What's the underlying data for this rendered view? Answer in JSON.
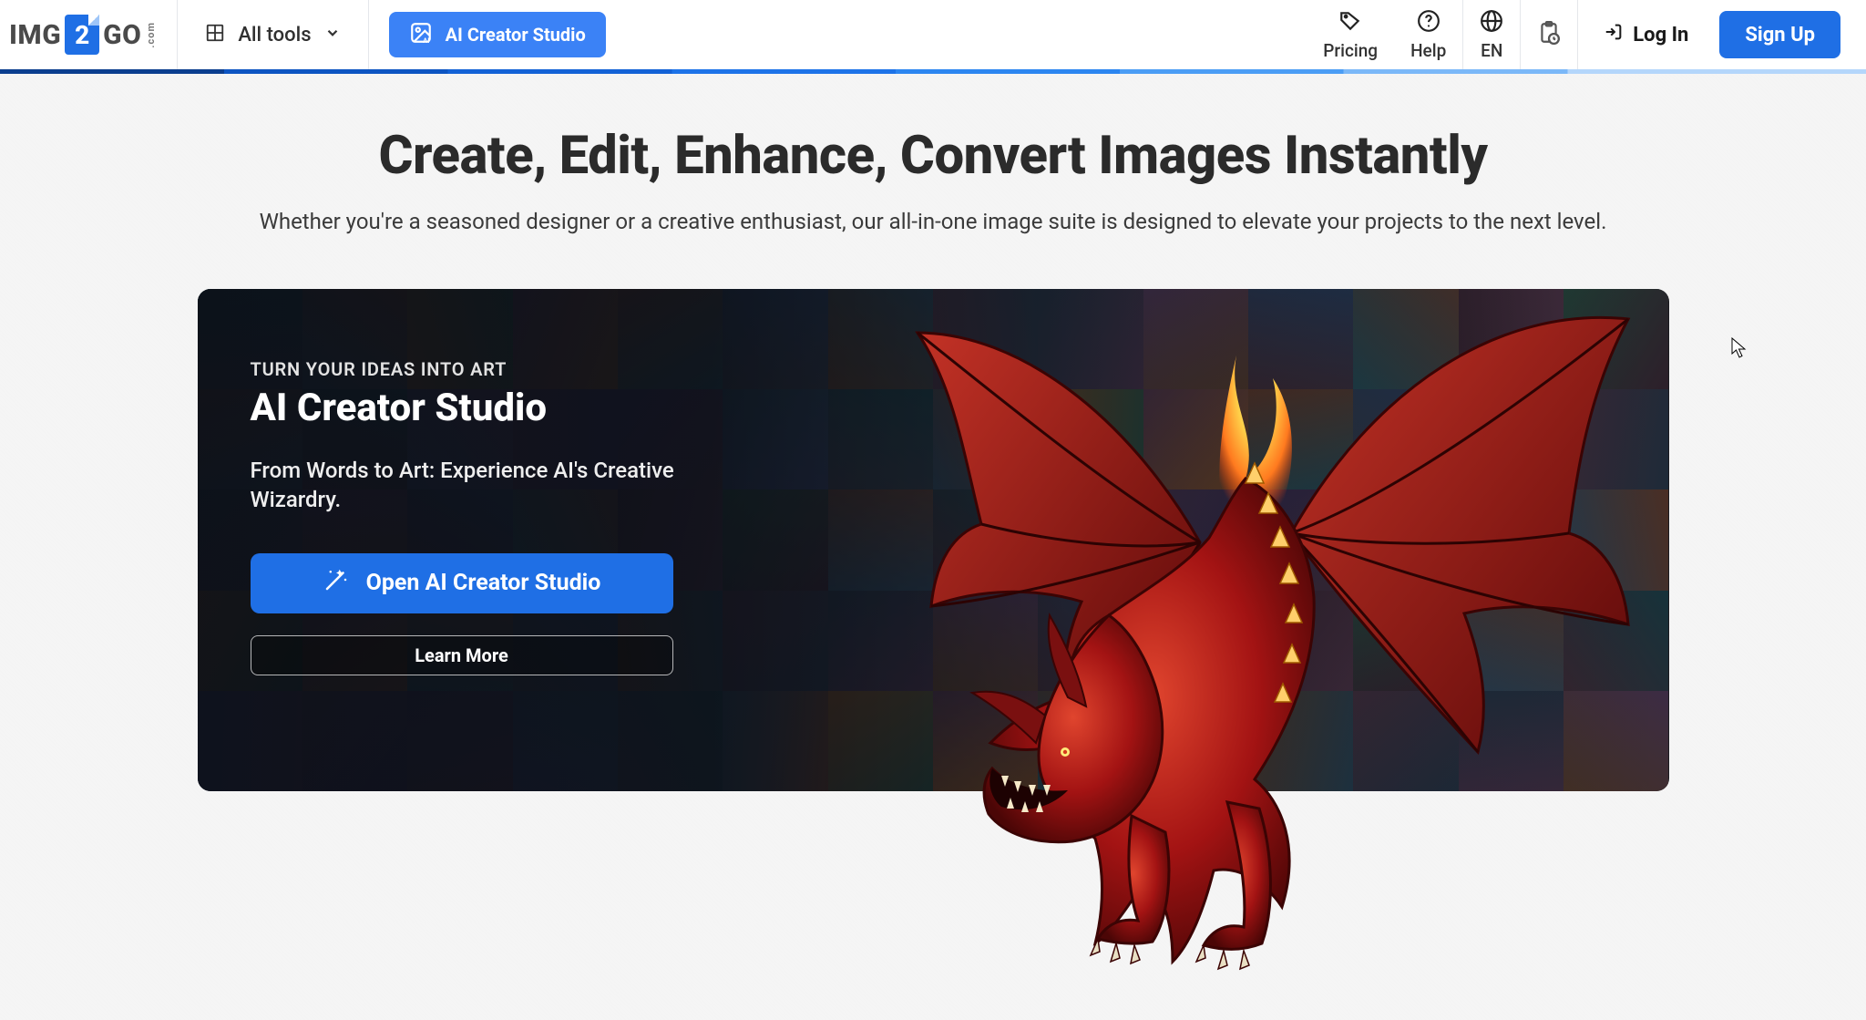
{
  "logo": {
    "part1": "IMG",
    "part2": "2",
    "part3": "GO",
    "suffix": ".com"
  },
  "nav": {
    "all_tools": "All tools",
    "ai_creator_studio": "AI Creator Studio",
    "pricing": "Pricing",
    "help": "Help",
    "language": "EN",
    "log_in": "Log In",
    "sign_up": "Sign Up"
  },
  "hero": {
    "title": "Create, Edit, Enhance, Convert Images Instantly",
    "subtitle": "Whether you're a seasoned designer or a creative enthusiast, our all-in-one image suite is designed to elevate your projects to the next level."
  },
  "banner": {
    "eyebrow": "TURN YOUR IDEAS INTO ART",
    "title": "AI Creator Studio",
    "description": "From Words to Art: Experience AI's Creative Wizardry.",
    "cta_primary": "Open AI Creator Studio",
    "cta_secondary": "Learn More"
  },
  "colors": {
    "accent": "#1f6fe5",
    "accent_light": "#3b82f6"
  }
}
